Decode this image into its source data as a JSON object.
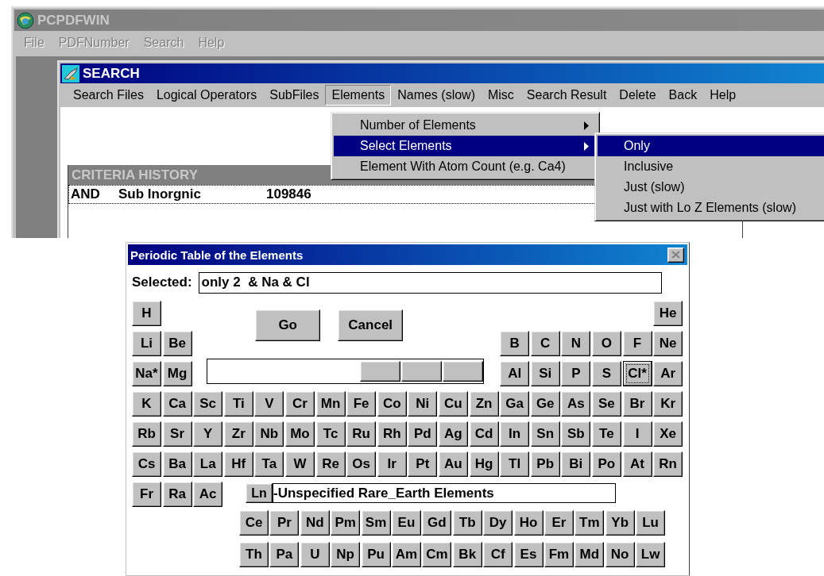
{
  "main_window": {
    "title": "PCPDFWIN",
    "menu": [
      {
        "label": "File",
        "disabled": true
      },
      {
        "label": "PDFNumber",
        "disabled": true
      },
      {
        "label": "Search",
        "disabled": true
      },
      {
        "label": "Help",
        "disabled": true
      }
    ]
  },
  "search_window": {
    "title": "SEARCH",
    "menu": [
      {
        "label": "Search Files",
        "open": false
      },
      {
        "label": "Logical Operators",
        "open": false
      },
      {
        "label": "SubFiles",
        "open": false
      },
      {
        "label": "Elements",
        "open": true
      },
      {
        "label": "Names (slow)",
        "open": false
      },
      {
        "label": "Misc",
        "open": false
      },
      {
        "label": "Search Result",
        "open": false
      },
      {
        "label": "Delete",
        "open": false
      },
      {
        "label": "Back",
        "open": false
      },
      {
        "label": "Help",
        "open": false
      }
    ],
    "criteria_history": {
      "title": "CRITERIA HISTORY",
      "rows": [
        {
          "operator": "AND",
          "criterion": "Sub Inorgnic",
          "count": "109846"
        }
      ]
    }
  },
  "elements_menu": {
    "items": [
      {
        "label": "Number of Elements",
        "submenu": true,
        "selected": false
      },
      {
        "label": "Select Elements",
        "submenu": true,
        "selected": true
      },
      {
        "label": "Element With Atom Count (e.g. Ca4)",
        "submenu": false,
        "selected": false
      }
    ]
  },
  "select_elements_menu": {
    "items": [
      {
        "label": "Only",
        "selected": true
      },
      {
        "label": "Inclusive",
        "selected": false
      },
      {
        "label": "Just (slow)",
        "selected": false
      },
      {
        "label": "Just with Lo Z Elements (slow)",
        "selected": false
      }
    ]
  },
  "periodic_dialog": {
    "title": "Periodic Table of the Elements",
    "selected_label": "Selected:",
    "selected_value": "only 2  & Na & Cl",
    "buttons": [
      {
        "label": "Go"
      },
      {
        "label": "Cancel"
      }
    ],
    "rows": [
      {
        "elements": [
          {
            "symbol": "H",
            "focused": false
          },
          {
            "symbol": "He",
            "focused": false
          }
        ]
      },
      {
        "elements": [
          {
            "symbol": "Li",
            "focused": false
          },
          {
            "symbol": "Be",
            "focused": false
          },
          {
            "symbol": "B",
            "focused": false
          },
          {
            "symbol": "C",
            "focused": false
          },
          {
            "symbol": "N",
            "focused": false
          },
          {
            "symbol": "O",
            "focused": false
          },
          {
            "symbol": "F",
            "focused": false
          },
          {
            "symbol": "Ne",
            "focused": false
          }
        ]
      },
      {
        "elements": [
          {
            "symbol": "Na*",
            "focused": false
          },
          {
            "symbol": "Mg",
            "focused": false
          },
          {
            "symbol": "Al",
            "focused": false
          },
          {
            "symbol": "Si",
            "focused": false
          },
          {
            "symbol": "P",
            "focused": false
          },
          {
            "symbol": "S",
            "focused": false
          },
          {
            "symbol": "Cl*",
            "focused": true
          },
          {
            "symbol": "Ar",
            "focused": false
          }
        ]
      },
      {
        "elements": [
          {
            "symbol": "K",
            "focused": false
          },
          {
            "symbol": "Ca",
            "focused": false
          },
          {
            "symbol": "Sc",
            "focused": false
          },
          {
            "symbol": "Ti",
            "focused": false
          },
          {
            "symbol": "V",
            "focused": false
          },
          {
            "symbol": "Cr",
            "focused": false
          },
          {
            "symbol": "Mn",
            "focused": false
          },
          {
            "symbol": "Fe",
            "focused": false
          },
          {
            "symbol": "Co",
            "focused": false
          },
          {
            "symbol": "Ni",
            "focused": false
          },
          {
            "symbol": "Cu",
            "focused": false
          },
          {
            "symbol": "Zn",
            "focused": false
          },
          {
            "symbol": "Ga",
            "focused": false
          },
          {
            "symbol": "Ge",
            "focused": false
          },
          {
            "symbol": "As",
            "focused": false
          },
          {
            "symbol": "Se",
            "focused": false
          },
          {
            "symbol": "Br",
            "focused": false
          },
          {
            "symbol": "Kr",
            "focused": false
          }
        ]
      },
      {
        "elements": [
          {
            "symbol": "Rb",
            "focused": false
          },
          {
            "symbol": "Sr",
            "focused": false
          },
          {
            "symbol": "Y",
            "focused": false
          },
          {
            "symbol": "Zr",
            "focused": false
          },
          {
            "symbol": "Nb",
            "focused": false
          },
          {
            "symbol": "Mo",
            "focused": false
          },
          {
            "symbol": "Tc",
            "focused": false
          },
          {
            "symbol": "Ru",
            "focused": false
          },
          {
            "symbol": "Rh",
            "focused": false
          },
          {
            "symbol": "Pd",
            "focused": false
          },
          {
            "symbol": "Ag",
            "focused": false
          },
          {
            "symbol": "Cd",
            "focused": false
          },
          {
            "symbol": "In",
            "focused": false
          },
          {
            "symbol": "Sn",
            "focused": false
          },
          {
            "symbol": "Sb",
            "focused": false
          },
          {
            "symbol": "Te",
            "focused": false
          },
          {
            "symbol": "I",
            "focused": false
          },
          {
            "symbol": "Xe",
            "focused": false
          }
        ]
      },
      {
        "elements": [
          {
            "symbol": "Cs",
            "focused": false
          },
          {
            "symbol": "Ba",
            "focused": false
          },
          {
            "symbol": "La",
            "focused": false
          },
          {
            "symbol": "Hf",
            "focused": false
          },
          {
            "symbol": "Ta",
            "focused": false
          },
          {
            "symbol": "W",
            "focused": false
          },
          {
            "symbol": "Re",
            "focused": false
          },
          {
            "symbol": "Os",
            "focused": false
          },
          {
            "symbol": "Ir",
            "focused": false
          },
          {
            "symbol": "Pt",
            "focused": false
          },
          {
            "symbol": "Au",
            "focused": false
          },
          {
            "symbol": "Hg",
            "focused": false
          },
          {
            "symbol": "Tl",
            "focused": false
          },
          {
            "symbol": "Pb",
            "focused": false
          },
          {
            "symbol": "Bi",
            "focused": false
          },
          {
            "symbol": "Po",
            "focused": false
          },
          {
            "symbol": "At",
            "focused": false
          },
          {
            "symbol": "Rn",
            "focused": false
          }
        ]
      },
      {
        "elements": [
          {
            "symbol": "Fr",
            "focused": false
          },
          {
            "symbol": "Ra",
            "focused": false
          },
          {
            "symbol": "Ac",
            "focused": false
          }
        ]
      }
    ],
    "rare_earth": {
      "button": "Ln",
      "description": "-Unspecified Rare_Earth Elements"
    },
    "lanthanides": [
      {
        "symbol": "Ce"
      },
      {
        "symbol": "Pr"
      },
      {
        "symbol": "Nd"
      },
      {
        "symbol": "Pm"
      },
      {
        "symbol": "Sm"
      },
      {
        "symbol": "Eu"
      },
      {
        "symbol": "Gd"
      },
      {
        "symbol": "Tb"
      },
      {
        "symbol": "Dy"
      },
      {
        "symbol": "Ho"
      },
      {
        "symbol": "Er"
      },
      {
        "symbol": "Tm"
      },
      {
        "symbol": "Yb"
      },
      {
        "symbol": "Lu"
      }
    ],
    "actinides": [
      {
        "symbol": "Th"
      },
      {
        "symbol": "Pa"
      },
      {
        "symbol": "U"
      },
      {
        "symbol": "Np"
      },
      {
        "symbol": "Pu"
      },
      {
        "symbol": "Am"
      },
      {
        "symbol": "Cm"
      },
      {
        "symbol": "Bk"
      },
      {
        "symbol": "Cf"
      },
      {
        "symbol": "Es"
      },
      {
        "symbol": "Fm"
      },
      {
        "symbol": "Md"
      },
      {
        "symbol": "No"
      },
      {
        "symbol": "Lw"
      }
    ]
  }
}
